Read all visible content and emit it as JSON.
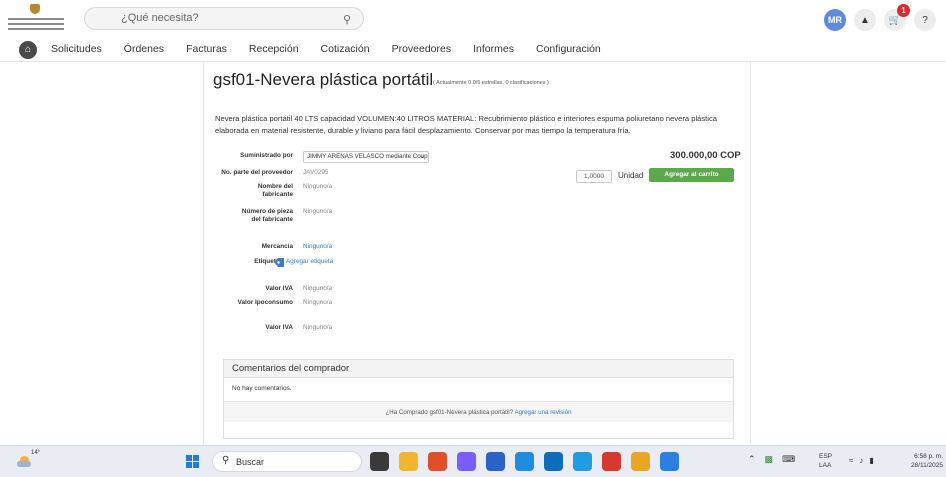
{
  "header": {
    "search_placeholder": "¿Qué necesita?",
    "avatar_initials": "MR",
    "cart_count": "1",
    "help_label": "?"
  },
  "nav": {
    "items": [
      "Solicitudes",
      "Órdenes",
      "Facturas",
      "Recepción",
      "Cotización",
      "Proveedores",
      "Informes",
      "Configuración"
    ]
  },
  "product": {
    "title": "gsf01-Nevera plástica portátil",
    "rating_text": "( Actualmente 0.0/5 estrellas. 0 clasificaciones )",
    "description": "Nevera plástica portátil 40 LTS capacidad VOLUMEN:40 LITROS MATERIAL: Recubrimiento plástico e interiores espuma poliuretano nevera plástica elaborada en material resistente, durable y liviano para fácil desplazamiento. Conservar por mas tiempo la temperatura fría.",
    "price": "300.000,00 COP",
    "quantity": "1,0000",
    "unit_label": "Unidad",
    "add_to_cart_label": "Agregar al carrito",
    "fields": {
      "supplied_by_label": "Suministrado por",
      "supplied_by_value": "JIMMY ARENAS VELASCO mediante Coup",
      "supplier_part_label": "No. parte del proveedor",
      "supplier_part_value": "JAV0295",
      "manufacturer_name_label": "Nombre del fabricante",
      "manufacturer_name_value": "Ninguno/a",
      "manufacturer_part_label": "Número de pieza del fabricante",
      "manufacturer_part_value": "Ninguno/a",
      "commodity_label": "Mercancía",
      "commodity_value": "Ninguno/a",
      "tags_label": "Etiquetas",
      "tags_value": "Agregar etiqueta",
      "iva_label": "Valor IVA",
      "iva_value": "Ninguno/a",
      "ipoconsumo_label": "Valor Ipoconsumo",
      "ipoconsumo_value": "Ninguno/a",
      "iva2_label": "Valor IVA",
      "iva2_value": "Ninguno/a"
    }
  },
  "comments": {
    "heading": "Comentarios del comprador",
    "empty_text": "No hay comentarios.",
    "footer_question": "¿Ha Comprado gsf01-Nevera plástica portátil?",
    "footer_link": "Agregar una revisión"
  },
  "taskbar": {
    "temperature": "14°",
    "search_label": "Buscar",
    "lang_line1": "ESP",
    "lang_line2": "LAA",
    "time": "6:58 p. m.",
    "date": "28/11/2025",
    "app_colors": [
      "#3a3a3a",
      "#f2b52e",
      "#e04f2a",
      "#7a5cff",
      "#2a62c9",
      "#1e8ce0",
      "#0f6cbd",
      "#1f9de0",
      "#d63a2f",
      "#e9a620",
      "#2b7fe0"
    ]
  }
}
